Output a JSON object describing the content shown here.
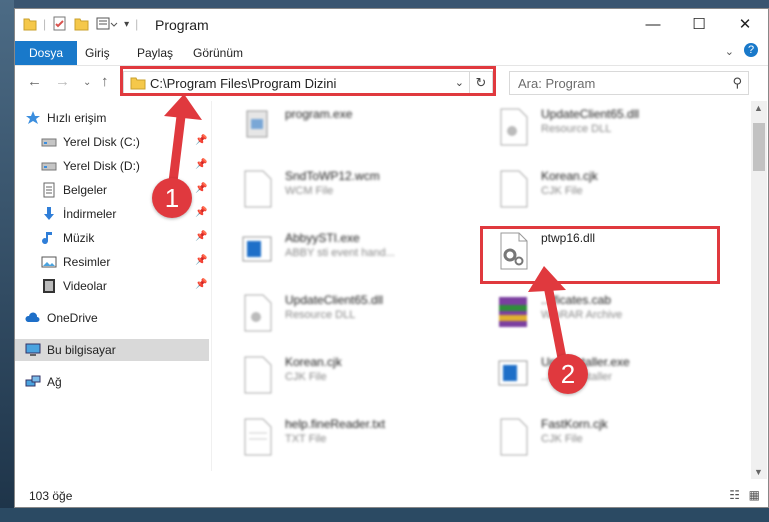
{
  "window": {
    "title": "Program"
  },
  "ribbon": {
    "tabs": [
      "Dosya",
      "Giriş",
      "Paylaş",
      "Görünüm"
    ]
  },
  "address": {
    "path": "C:\\Program Files\\Program Dizini"
  },
  "search": {
    "placeholder": "Ara: Program"
  },
  "sidebar": {
    "items": [
      {
        "label": "Hızlı erişim",
        "icon": "star-icon"
      },
      {
        "label": "Yerel Disk (C:)",
        "icon": "drive-icon"
      },
      {
        "label": "Yerel Disk (D:)",
        "icon": "drive-icon"
      },
      {
        "label": "Belgeler",
        "icon": "documents-icon"
      },
      {
        "label": "İndirmeler",
        "icon": "download-icon"
      },
      {
        "label": "Müzik",
        "icon": "music-icon"
      },
      {
        "label": "Resimler",
        "icon": "pictures-icon"
      },
      {
        "label": "Videolar",
        "icon": "videos-icon"
      },
      {
        "label": "OneDrive",
        "icon": "cloud-icon"
      },
      {
        "label": "Bu bilgisayar",
        "icon": "computer-icon"
      },
      {
        "label": "Ağ",
        "icon": "network-icon"
      }
    ]
  },
  "files": [
    {
      "name": "program.exe",
      "type": ""
    },
    {
      "name": "UpdateClient65.dll",
      "type": "Resource DLL"
    },
    {
      "name": "SndToWP12.wcm",
      "type": "WCM File"
    },
    {
      "name": "Korean.cjk",
      "type": "CJK File"
    },
    {
      "name": "AbbyySTI.exe",
      "type": "ABBY sti event hand..."
    },
    {
      "name": "ptwp16.dll",
      "type": ""
    },
    {
      "name": "UpdateClient65.dll",
      "type": "Resource DLL"
    },
    {
      "name": "...ificates.cab",
      "type": "WinRAR Archive"
    },
    {
      "name": "Korean.cjk",
      "type": "CJK File"
    },
    {
      "name": "Up...installer.exe",
      "type": "...ates installer"
    },
    {
      "name": "help.fineReader.txt",
      "type": "TXT File"
    },
    {
      "name": "FastKorn.cjk",
      "type": "CJK File"
    }
  ],
  "status": {
    "count": "103 öğe"
  },
  "annotations": {
    "step1": "1",
    "step2": "2"
  },
  "colors": {
    "accent": "#1979ca",
    "highlight": "#e0393e"
  }
}
